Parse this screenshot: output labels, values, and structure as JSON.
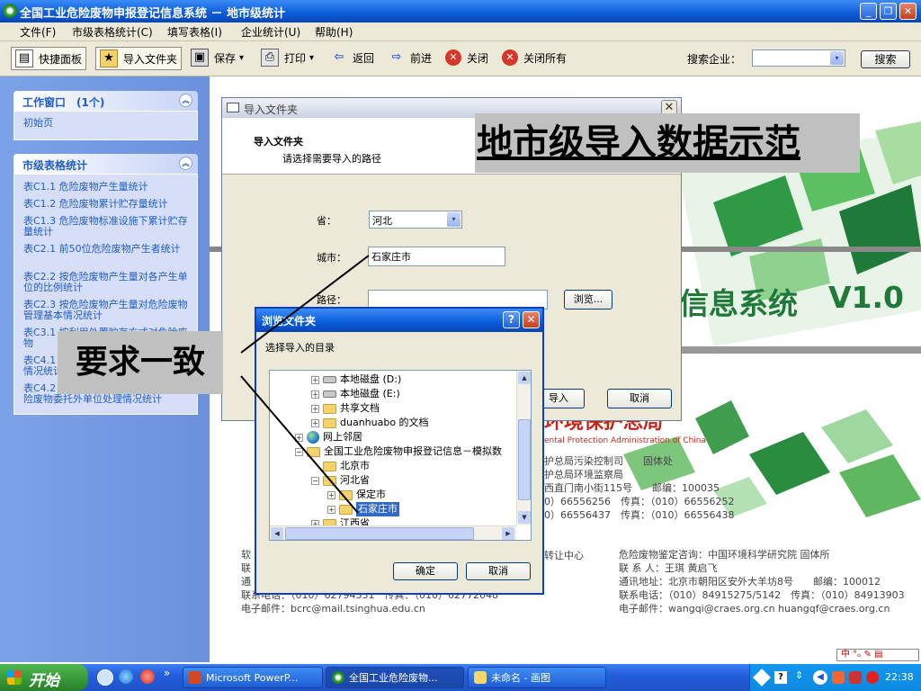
{
  "app": {
    "title": "全国工业危险废物申报登记信息系统 － 地市级统计",
    "win_min": "_",
    "win_max": "❐",
    "win_close": "✕"
  },
  "menu": [
    "文件(F)",
    "市级表格统计(C)",
    "填写表格(I)",
    "企业统计(U)",
    "帮助(H)"
  ],
  "toolbar": {
    "quick_panel": "快捷面板",
    "import_folder": "导入文件夹",
    "save": "保存",
    "print": "打印",
    "back": "返回",
    "forward": "前进",
    "close": "关闭",
    "close_all": "关闭所有",
    "dropdown_arrow": "▾",
    "search_label": "搜索企业：",
    "search_button": "搜索"
  },
  "sidebar": {
    "work_window_title": "工作窗口　(1个)",
    "work_items": [
      "初始页"
    ],
    "stats_title": "市级表格统计",
    "stats_items": [
      "表C1.1 危险废物产生量统计",
      "表C1.2 危险废物累计贮存量统计",
      "表C1.3 危险废物标准设施下累计贮存量统计",
      "表C2.1 前50位危险废物产生者统计",
      "表C2.2 按危险废物产生量对各产生单位的比例统计",
      "表C2.3 按危险废物产生量对危险废物管理基本情况统计",
      "表C3.1 按利用处置贮存方式对危险废物",
      "表C4.1",
      "情况统计",
      "表C4.2",
      "险废物委托外单位处理情况统计"
    ]
  },
  "import_dialog": {
    "title": "导入文件夹",
    "header_title": "导入文件夹",
    "header_subtitle": "请选择需要导入的路径",
    "province_label": "省：",
    "province_value": "河北",
    "city_label": "城市：",
    "city_value": "石家庄市",
    "path_label": "路径：",
    "path_value": "",
    "browse_button": "浏览...",
    "import_button": "导入",
    "cancel_button": "取消"
  },
  "browse_dialog": {
    "title": "浏览文件夹",
    "help": "?",
    "prompt": "选择导入的目录",
    "tree": [
      {
        "label": "本地磁盘 (D:)",
        "type": "drive",
        "expander": "+"
      },
      {
        "label": "本地磁盘 (E:)",
        "type": "drive",
        "expander": "+"
      },
      {
        "label": "共享文档",
        "type": "folder",
        "expander": "+"
      },
      {
        "label": "duanhuabo 的文档",
        "type": "folder",
        "expander": "+"
      },
      {
        "label": "网上邻居",
        "type": "globe",
        "expander": "+"
      },
      {
        "label": "全国工业危险废物申报登记信息－模拟数",
        "type": "folder",
        "expander": "−"
      },
      {
        "label": "北京市",
        "type": "folder",
        "expander": ""
      },
      {
        "label": "河北省",
        "type": "folder",
        "expander": "−"
      },
      {
        "label": "保定市",
        "type": "folder",
        "expander": "+"
      },
      {
        "label": "石家庄市",
        "type": "folder",
        "expander": "+",
        "selected": true
      },
      {
        "label": "江西省",
        "type": "folder",
        "expander": "+"
      }
    ],
    "ok_button": "确定",
    "cancel_button": "取消"
  },
  "background": {
    "system_title": "信息系统",
    "version": "V1.0",
    "org_fragment": "环境保护总局",
    "org_en": "ental Protection Administration of China",
    "lines": [
      "护总局污染控制司　　固体处",
      "护总局环境监察局",
      "西直门南小街115号　　邮编：100035",
      "0）66556256　传真：（010）66556252",
      "0）66556437　传真：（010）66556438"
    ],
    "left_footer": [
      "软",
      "联",
      "通",
      "联系电话：（010）62794331　传真：（010）62772048",
      "电子邮件：bcrc@mail.tsinghua.edu.cn"
    ],
    "center_fragment": "转让中心",
    "right_footer": [
      "危险废物鉴定咨询：中国环境科学研究院  固体所",
      "联 系 人：王琪 黄启飞",
      "通讯地址：北京市朝阳区安外大羊坊8号　　邮编：100012",
      "联系电话：（010）84915275/5142　传真：（010）84913903",
      "电子邮件：wangqi@craes.org.cn  huangqf@craes.org.cn"
    ],
    "ime": "中"
  },
  "callouts": {
    "heading": "地市级导入数据示范",
    "consistent": "要求一致"
  },
  "taskbar": {
    "start": "开始",
    "tasks": [
      "Microsoft PowerP...",
      "全国工业危险废物...",
      "未命名 - 画图"
    ],
    "more": "»",
    "clock": "22:38"
  },
  "colors": {
    "xp_blue": "#0a5bd8",
    "green_accent": "#1f7a3a",
    "red_text": "#c0281e"
  }
}
